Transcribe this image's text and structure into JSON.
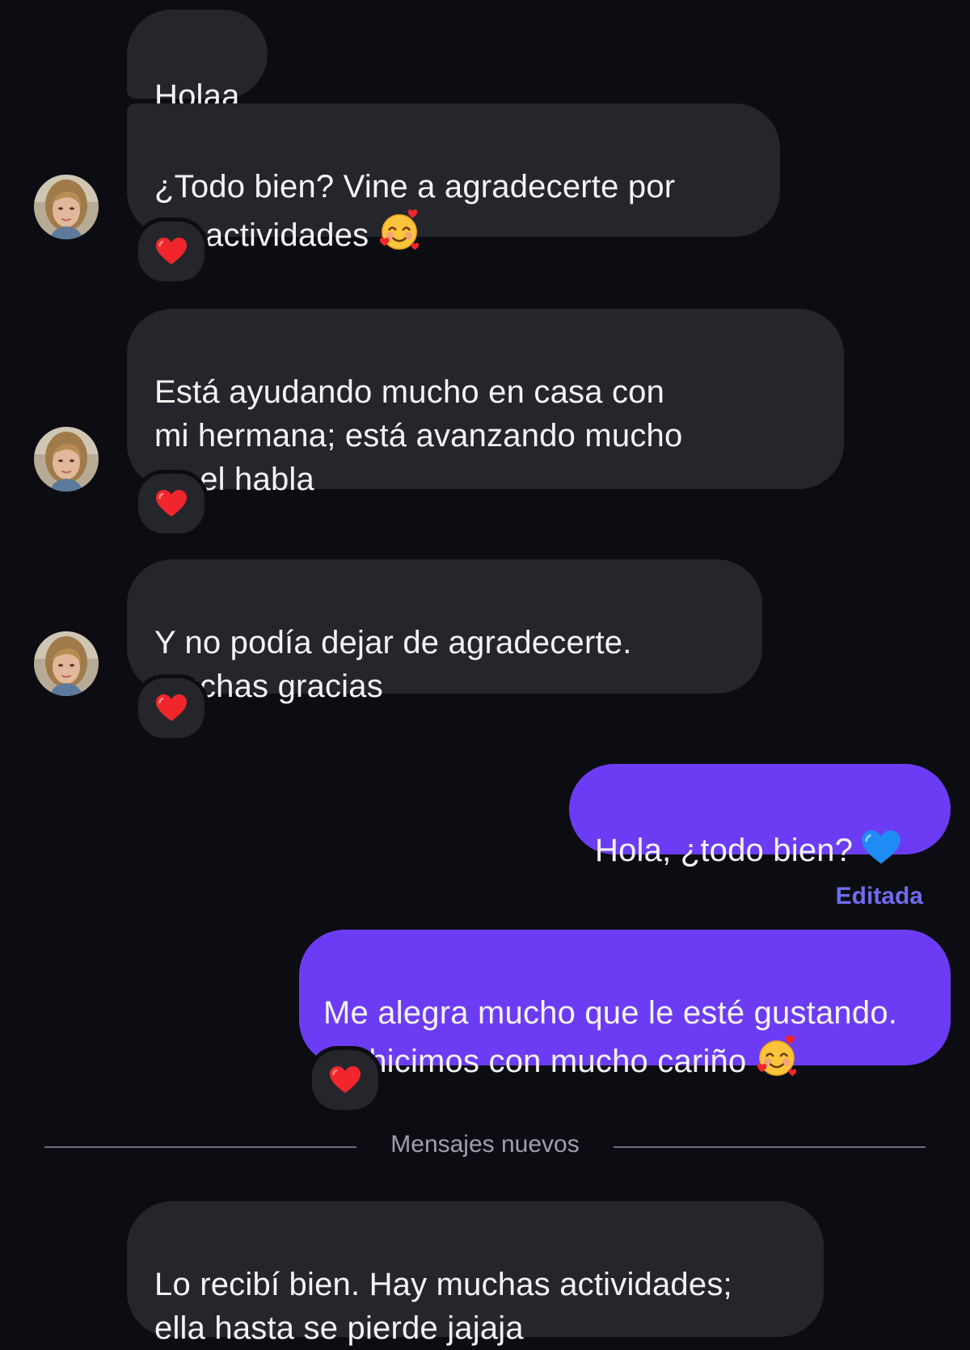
{
  "conversation": {
    "messages": [
      {
        "direction": "incoming",
        "text": "Holaa"
      },
      {
        "direction": "incoming",
        "text": "¿Todo bien? Vine a agradecerte por\nlas actividades",
        "emoji": "smiling-face-with-hearts",
        "reaction": "red-heart"
      },
      {
        "direction": "incoming",
        "text": "Está ayudando mucho en casa con\nmi hermana; está avanzando mucho\nen el habla",
        "reaction": "red-heart"
      },
      {
        "direction": "incoming",
        "text": "Y no podía dejar de agradecerte.\nMuchas gracias",
        "reaction": "red-heart"
      },
      {
        "direction": "outgoing",
        "text": "Hola, ¿todo bien?",
        "emoji": "blue-heart"
      },
      {
        "direction": "outgoing",
        "edited_label": "Editada",
        "text": "Me alegra mucho que le esté gustando.\nLo hicimos con mucho cariño",
        "emoji": "smiling-face-with-hearts",
        "reaction": "red-heart"
      },
      {
        "direction": "incoming",
        "text": "Lo recibí bien. Hay muchas actividades;\nella hasta se pierde jajaja"
      }
    ],
    "new_messages_label": "Mensajes nuevos"
  },
  "colors": {
    "background": "#0c0d12",
    "incoming_bubble": "#25262b",
    "outgoing_bubble": "#6c3cf4",
    "edited_label": "#6f6cf0",
    "divider": "#6e6f77"
  }
}
